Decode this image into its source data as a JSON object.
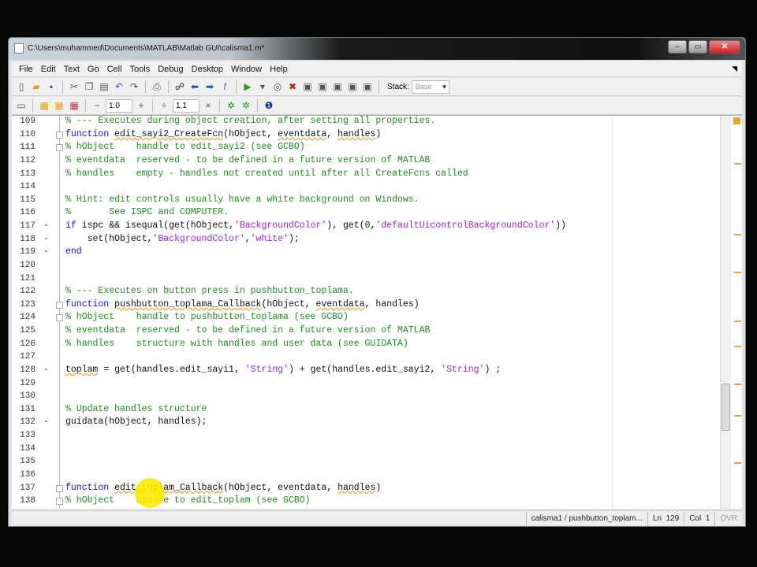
{
  "window": {
    "title": "C:\\Users\\muhammed\\Documents\\MATLAB\\Matlab GUI\\calisma1.m*",
    "min": "–",
    "max": "▭",
    "close": "✕"
  },
  "menu": [
    "File",
    "Edit",
    "Text",
    "Go",
    "Cell",
    "Tools",
    "Debug",
    "Desktop",
    "Window",
    "Help"
  ],
  "toolbar": {
    "stack_label": "Stack:",
    "stack_value": "Base",
    "cell_minus": "−",
    "cell_value1": "1.0",
    "cell_plus": "+",
    "cell_div": "÷",
    "cell_value2": "1.1",
    "cell_times": "×"
  },
  "editor": {
    "lines": [
      {
        "n": "109",
        "d": "",
        "t": [
          [
            "% --- Executes during object creation, after setting all properties.",
            "c"
          ]
        ]
      },
      {
        "n": "110",
        "d": "",
        "f": 1,
        "t": [
          [
            "function ",
            "k"
          ],
          [
            "edit_sayi2_CreateFcn",
            "pu"
          ],
          [
            "(hObject, ",
            "p"
          ],
          [
            "eventdata",
            "pu"
          ],
          [
            ", ",
            "p"
          ],
          [
            "handles",
            "pu"
          ],
          [
            ")",
            "p"
          ]
        ]
      },
      {
        "n": "111",
        "d": "",
        "f": 1,
        "t": [
          [
            "% hObject    handle to edit_sayi2 (see GCBO)",
            "c"
          ]
        ]
      },
      {
        "n": "112",
        "d": "",
        "t": [
          [
            "% eventdata  reserved - to be defined in a future version of MATLAB",
            "c"
          ]
        ]
      },
      {
        "n": "113",
        "d": "",
        "t": [
          [
            "% handles    empty - handles not created until after all CreateFcns called",
            "c"
          ]
        ]
      },
      {
        "n": "114",
        "d": "",
        "t": []
      },
      {
        "n": "115",
        "d": "",
        "t": [
          [
            "% Hint: edit controls usually have a white background on Windows.",
            "c"
          ]
        ]
      },
      {
        "n": "116",
        "d": "",
        "t": [
          [
            "%       See ISPC and COMPUTER.",
            "c"
          ]
        ]
      },
      {
        "n": "117",
        "d": "-",
        "t": [
          [
            "if ",
            "k"
          ],
          [
            "ispc && isequal(get(hObject,",
            "p"
          ],
          [
            "'BackgroundColor'",
            "s"
          ],
          [
            "), get(0,",
            "p"
          ],
          [
            "'defaultUicontrolBackgroundColor'",
            "s"
          ],
          [
            "))",
            "p"
          ]
        ]
      },
      {
        "n": "118",
        "d": "-",
        "t": [
          [
            "    set(hObject,",
            "p"
          ],
          [
            "'BackgroundColor'",
            "s"
          ],
          [
            ",",
            "p"
          ],
          [
            "'white'",
            "s"
          ],
          [
            ");",
            "p"
          ]
        ]
      },
      {
        "n": "119",
        "d": "-",
        "t": [
          [
            "end",
            "k"
          ]
        ]
      },
      {
        "n": "120",
        "d": "",
        "t": []
      },
      {
        "n": "121",
        "d": "",
        "t": []
      },
      {
        "n": "122",
        "d": "",
        "t": [
          [
            "% --- Executes on button press in pushbutton_toplama.",
            "c"
          ]
        ]
      },
      {
        "n": "123",
        "d": "",
        "f": 1,
        "t": [
          [
            "function ",
            "k"
          ],
          [
            "pushbutton_toplama_Callback",
            "pu"
          ],
          [
            "(hObject, ",
            "p"
          ],
          [
            "eventdata",
            "pu"
          ],
          [
            ", handles)",
            "p"
          ]
        ]
      },
      {
        "n": "124",
        "d": "",
        "f": 1,
        "t": [
          [
            "% hObject    handle to pushbutton_toplama (see GCBO)",
            "c"
          ]
        ]
      },
      {
        "n": "125",
        "d": "",
        "t": [
          [
            "% eventdata  reserved - to be defined in a future version of MATLAB",
            "c"
          ]
        ]
      },
      {
        "n": "126",
        "d": "",
        "t": [
          [
            "% handles    structure with handles and user data (see GUIDATA)",
            "c"
          ]
        ]
      },
      {
        "n": "127",
        "d": "",
        "t": []
      },
      {
        "n": "128",
        "d": "-",
        "t": [
          [
            "toplam",
            "pu"
          ],
          [
            " = get(handles.edit_sayi1, ",
            "p"
          ],
          [
            "'String'",
            "s"
          ],
          [
            ") + get(handles.edit_sayi2, ",
            "p"
          ],
          [
            "'String'",
            "s"
          ],
          [
            ") ;",
            "p"
          ]
        ]
      },
      {
        "n": "129",
        "d": "",
        "t": []
      },
      {
        "n": "130",
        "d": "",
        "t": []
      },
      {
        "n": "131",
        "d": "",
        "t": [
          [
            "% Update handles structure",
            "c"
          ]
        ]
      },
      {
        "n": "132",
        "d": "-",
        "t": [
          [
            "guidata(hObject, handles);",
            "p"
          ]
        ]
      },
      {
        "n": "133",
        "d": "",
        "t": []
      },
      {
        "n": "134",
        "d": "",
        "t": []
      },
      {
        "n": "135",
        "d": "",
        "t": []
      },
      {
        "n": "136",
        "d": "",
        "t": []
      },
      {
        "n": "137",
        "d": "",
        "f": 1,
        "t": [
          [
            "function ",
            "k"
          ],
          [
            "edit_toplam_Callback",
            "pu"
          ],
          [
            "(hObject, eventdata, ",
            "p"
          ],
          [
            "handles",
            "pu"
          ],
          [
            ")",
            "p"
          ]
        ]
      },
      {
        "n": "138",
        "d": "",
        "f": 1,
        "t": [
          [
            "% hObject    handle to edit_toplam (see GCBO)",
            "c"
          ]
        ]
      }
    ]
  },
  "status": {
    "function": "calisma1 / pushbutton_toplam...",
    "ln_label": "Ln",
    "ln": "129",
    "col_label": "Col",
    "col": "1",
    "ovr": "OVR"
  },
  "colors": {
    "keyword": "#1010ff",
    "comment": "#228b22",
    "string": "#a020f0",
    "warning": "#e8a33a"
  }
}
